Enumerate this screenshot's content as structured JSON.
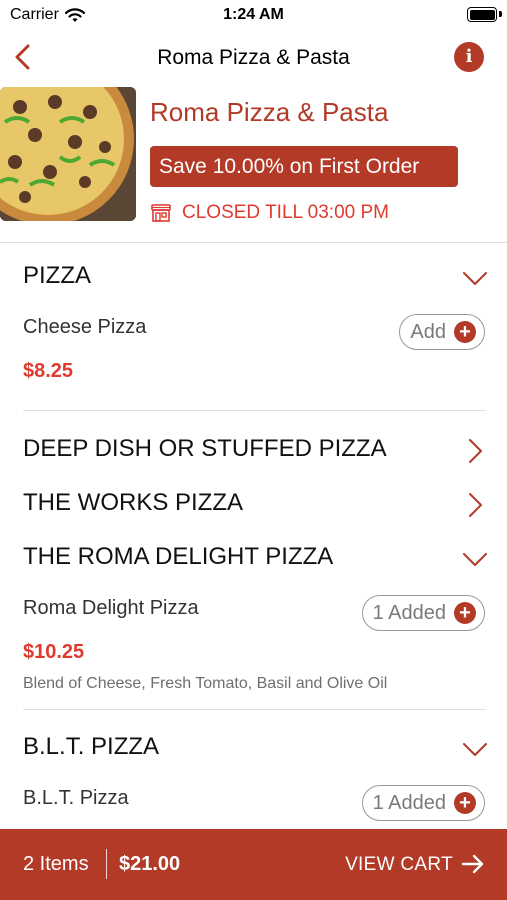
{
  "status_bar": {
    "carrier": "Carrier",
    "time": "1:24 AM"
  },
  "nav": {
    "title": "Roma Pizza & Pasta",
    "back_icon": "chevron-left-icon",
    "info_icon": "info-icon"
  },
  "restaurant": {
    "name": "Roma Pizza & Pasta",
    "promo": "Save 10.00% on First Order",
    "status": "CLOSED TILL 03:00 PM",
    "status_icon": "store-icon"
  },
  "menu": {
    "pizza": {
      "label": "PIZZA",
      "item": {
        "name": "Cheese Pizza",
        "price": "$8.25",
        "button": "Add"
      }
    },
    "deep_dish": {
      "label": "DEEP DISH OR STUFFED PIZZA"
    },
    "works": {
      "label": "THE WORKS PIZZA"
    },
    "roma_delight": {
      "label": "THE ROMA DELIGHT PIZZA",
      "item": {
        "name": "Roma Delight Pizza",
        "price": "$10.25",
        "description": "Blend of Cheese, Fresh Tomato, Basil and Olive Oil",
        "button": "1 Added"
      }
    },
    "blt": {
      "label": "B.L.T. PIZZA",
      "item": {
        "name": "B.L.T. Pizza",
        "button": "1 Added"
      }
    }
  },
  "cart": {
    "count": "2 Items",
    "total": "$21.00",
    "action": "VIEW CART"
  },
  "colors": {
    "brand": "#b23a27",
    "price": "#e03a2f",
    "status": "#e03a2f"
  }
}
